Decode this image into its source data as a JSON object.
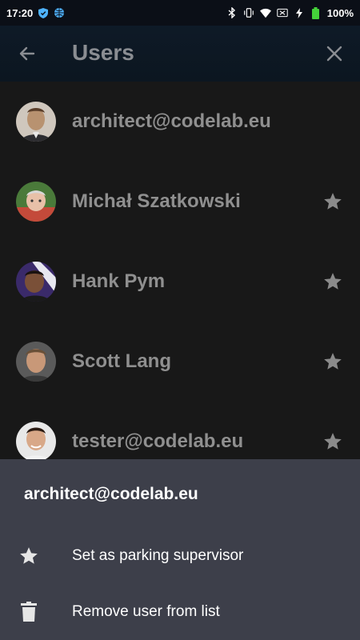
{
  "status_bar": {
    "time": "17:20",
    "battery": "100%"
  },
  "app_bar": {
    "title": "Users",
    "back_icon": "arrow-left-icon",
    "close_icon": "close-icon"
  },
  "users": [
    {
      "name": "architect@codelab.eu",
      "starred": false,
      "avatar_color": "#9a8a78"
    },
    {
      "name": "Michał Szatkowski",
      "starred": true,
      "avatar_color": "#b07a5c"
    },
    {
      "name": "Hank Pym",
      "starred": true,
      "avatar_color": "#6a4a3a"
    },
    {
      "name": "Scott Lang",
      "starred": true,
      "avatar_color": "#8a7060"
    },
    {
      "name": "tester@codelab.eu",
      "starred": true,
      "avatar_color": "#c09080"
    }
  ],
  "bottom_sheet": {
    "title": "architect@codelab.eu",
    "actions": [
      {
        "label": "Set as parking supervisor",
        "icon": "star-icon"
      },
      {
        "label": "Remove user from list",
        "icon": "trash-icon"
      }
    ]
  },
  "colors": {
    "background": "#181818",
    "app_bar": "#0e1a27",
    "sheet": "#3d3f4a",
    "muted_text": "#8f8f8f",
    "star": "#8a8a8a"
  }
}
